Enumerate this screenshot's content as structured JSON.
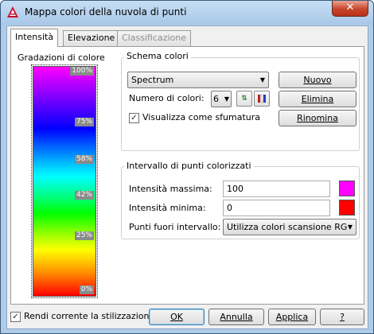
{
  "window": {
    "title": "Mappa colori della nuvola di punti",
    "close_label": "✕"
  },
  "tabs": [
    {
      "label": "Intensità",
      "state": "active"
    },
    {
      "label": "Elevazione",
      "state": "normal"
    },
    {
      "label": "Classificazione",
      "state": "disabled"
    }
  ],
  "gradient": {
    "label": "Gradazioni di colore",
    "ticks": [
      "100%",
      "75%",
      "58%",
      "42%",
      "25%",
      "0%"
    ]
  },
  "scheme": {
    "title": "Schema colori",
    "selected": "Spectrum",
    "count_label": "Numero di colori:",
    "count_value": "6",
    "show_gradient_label": "Visualizza come sfumatura",
    "show_gradient_checked": true,
    "new_button": "Nuovo",
    "delete_button": "Elimina",
    "rename_button": "Rinomina"
  },
  "range": {
    "title": "Intervallo di punti colorizzati",
    "max_label": "Intensità massima:",
    "max_value": "100",
    "max_color": "#ff00ff",
    "min_label": "Intensità minima:",
    "min_value": "0",
    "min_color": "#ff0000",
    "out_label": "Punti fuori intervallo:",
    "out_value": "Utilizza colori scansione RG"
  },
  "footer": {
    "current_style_label": "Rendi corrente la stilizzazione",
    "current_style_checked": true,
    "ok": "OK",
    "cancel": "Annulla",
    "apply": "Applica",
    "help": "?"
  }
}
